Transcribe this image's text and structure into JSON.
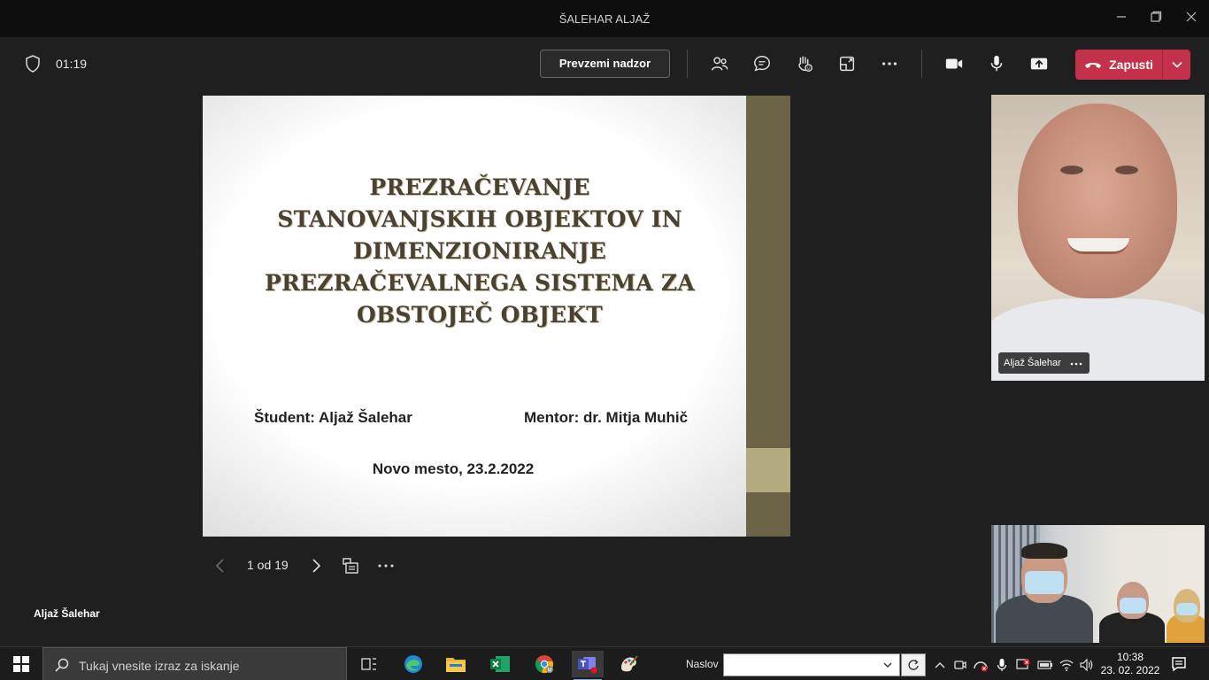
{
  "window": {
    "title": "ŠALEHAR ALJAŽ"
  },
  "toolbar": {
    "timer": "01:19",
    "take_control_label": "Prevzemi nadzor",
    "leave_label": "Zapusti"
  },
  "slide": {
    "title": "PREZRAČEVANJE STANOVANJSKIH OBJEKTOV IN DIMENZIONIRANJE PREZRAČEVALNEGA SISTEMA ZA OBSTOJEČ OBJEKT",
    "student": "Študent: Aljaž Šalehar",
    "mentor": "Mentor: dr. Mitja Muhič",
    "place_date": "Novo mesto, 23.2.2022"
  },
  "slide_nav": {
    "counter": "1 od 19"
  },
  "presenter_name": "Aljaž Šalehar",
  "participants": [
    {
      "name": "Aljaž Šalehar"
    }
  ],
  "taskbar": {
    "search_placeholder": "Tukaj vnesite izraz za iskanje",
    "naslov_label": "Naslov",
    "clock_time": "10:38",
    "clock_date": "23. 02. 2022"
  },
  "colors": {
    "leave_red": "#c4314b",
    "slide_band": "#6b6446",
    "slide_band_light": "#b1ab7f",
    "title_brown": "#4a4130"
  }
}
